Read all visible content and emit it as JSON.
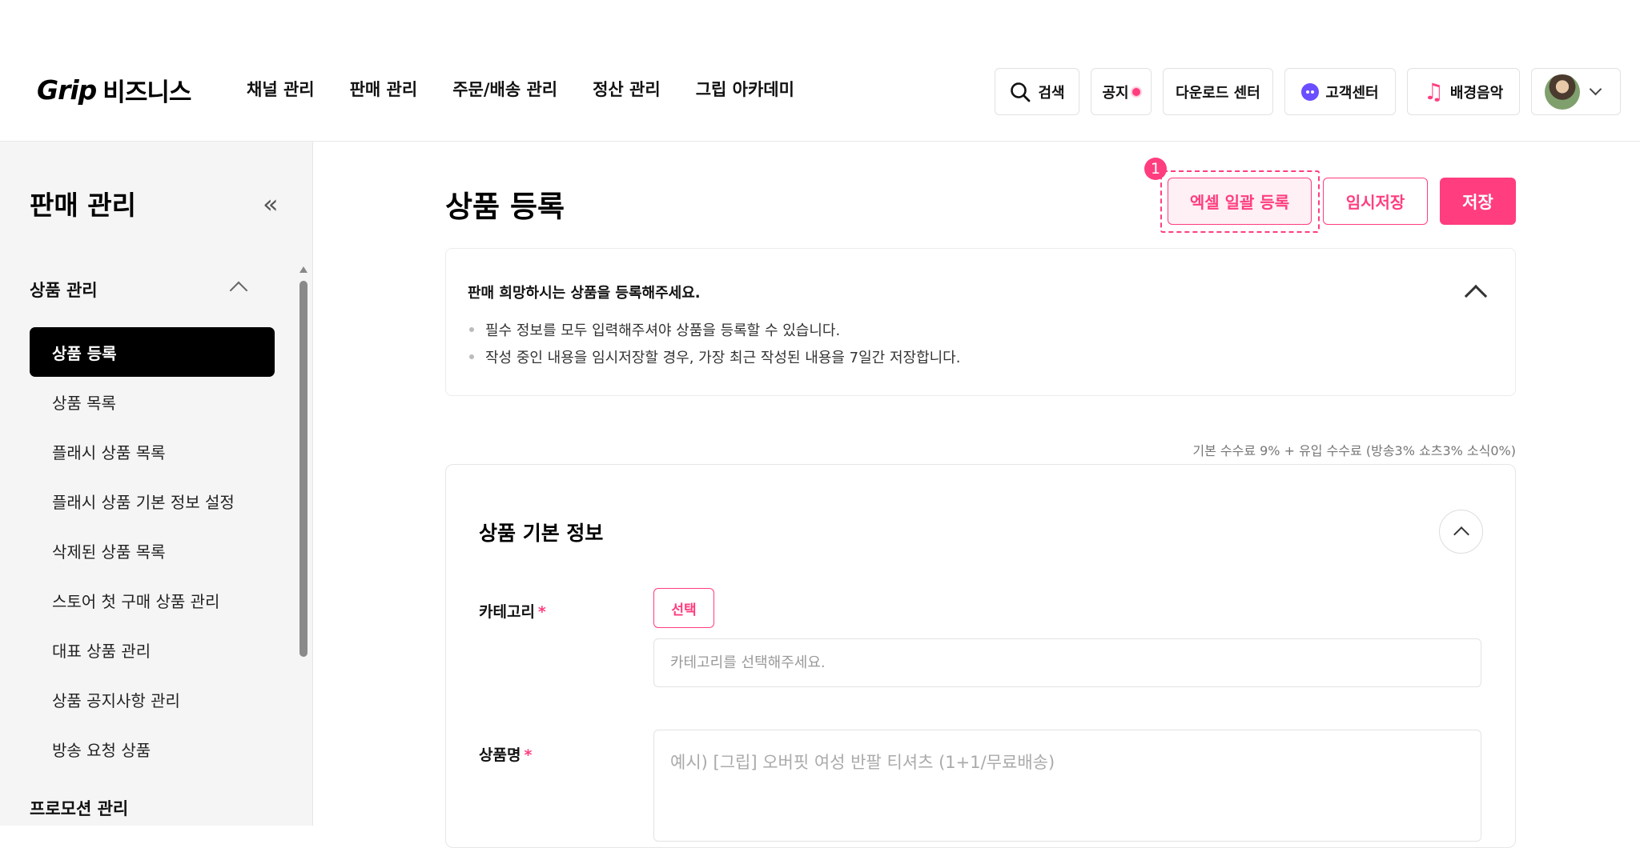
{
  "header": {
    "logo_main": "Grip",
    "logo_sub": "비즈니스",
    "nav": [
      "채널 관리",
      "판매 관리",
      "주문/배송 관리",
      "정산 관리",
      "그립 아카데미"
    ],
    "search_label": "검색",
    "notice_label": "공지",
    "download_label": "다운로드 센터",
    "support_label": "고객센터",
    "bgm_label": "배경음악",
    "accent_color": "#ff3d7f"
  },
  "sidebar": {
    "title": "판매 관리",
    "section_title": "상품 관리",
    "items": [
      {
        "label": "상품 등록",
        "active": true
      },
      {
        "label": "상품 목록"
      },
      {
        "label": "플래시 상품 목록"
      },
      {
        "label": "플래시 상품 기본 정보 설정"
      },
      {
        "label": "삭제된 상품 목록"
      },
      {
        "label": "스토어 첫 구매 상품 관리"
      },
      {
        "label": "대표 상품 관리"
      },
      {
        "label": "상품 공지사항 관리"
      },
      {
        "label": "방송 요청 상품"
      }
    ],
    "section2_title": "프로모션 관리"
  },
  "main": {
    "title": "상품 등록",
    "excel_button": "엑셀 일괄 등록",
    "temp_save_button": "임시저장",
    "save_button": "저장",
    "step_badge": "1",
    "info": {
      "title": "판매 희망하시는 상품을 등록해주세요.",
      "notes": [
        "필수 정보를 모두 입력해주셔야 상품을 등록할 수 있습니다.",
        "작성 중인 내용을 임시저장할 경우, 가장 최근 작성된 내용을 7일간 저장합니다."
      ]
    },
    "fee_text": "기본 수수료 9% + 유입 수수료 (방송3% 쇼츠3% 소식0%)",
    "card": {
      "title": "상품 기본 정보",
      "category_label": "카테고리",
      "required_mark": "*",
      "select_button": "선택",
      "category_placeholder": "카테고리를 선택해주세요.",
      "name_label": "상품명",
      "name_placeholder": "예시) [그립] 오버핏 여성 반팔 티셔츠 (1+1/무료배송)"
    }
  }
}
